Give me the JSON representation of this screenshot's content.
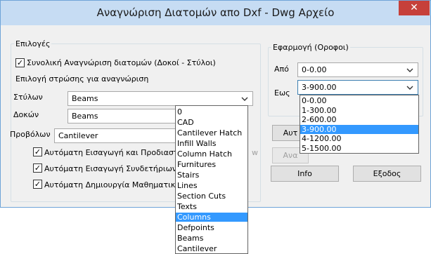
{
  "window": {
    "title": "Αναγνώριση Διατομών απο Dxf - Dwg Αρχείο",
    "close_label": "✕"
  },
  "options": {
    "legend": "Επιλογές",
    "total_recognition": {
      "label": "Συνολική Αναγνώριση διατομών (Δοκοί - Στύλοι)",
      "checked": true
    },
    "layer_title": "Επιλογή στρώσης για αναγνώριση",
    "columns": {
      "label": "Στύλων",
      "value": "Beams"
    },
    "beams": {
      "label": "Δοκών",
      "value": "Beams"
    },
    "cantilevers": {
      "label": "Προβόλων",
      "value": "Cantilever"
    },
    "auto_insert": {
      "label": "Αυτόματη Εισαγωγή και Προδιαστα",
      "checked": true
    },
    "auto_connectors": {
      "label": "Αυτόματη Εισαγωγή Συνδετήριων",
      "checked": true
    },
    "auto_model": {
      "label": "Αυτόματη Δημιουργία Μαθηματικο",
      "checked": true
    }
  },
  "floors": {
    "legend": "Εφαρμογή (Οροφοι)",
    "from": {
      "label": "Από",
      "value": "0-0.00"
    },
    "to": {
      "label": "Εως",
      "value": "3-900.00"
    },
    "to_options": [
      "0-0.00",
      "1-300.00",
      "2-600.00",
      "3-900.00",
      "4-1200.00",
      "5-1500.00"
    ],
    "to_selected_index": 3
  },
  "layer_dropdown": {
    "options": [
      "0",
      "CAD",
      "Cantilever Hatch",
      "Infill Walls",
      "Column Hatch",
      "Furnitures",
      "Stairs",
      "Lines",
      "Section Cuts",
      "Texts",
      "Columns",
      "Defpoints",
      "Beams",
      "Cantilever"
    ],
    "selected_index": 10
  },
  "buttons": {
    "auto": "Αυτ",
    "analysis": "Ανα",
    "info": "Info",
    "exit": "Εξοδος"
  },
  "colors": {
    "title_bar": "#c6dcf3",
    "close": "#c6403a",
    "selection": "#3399ff"
  }
}
